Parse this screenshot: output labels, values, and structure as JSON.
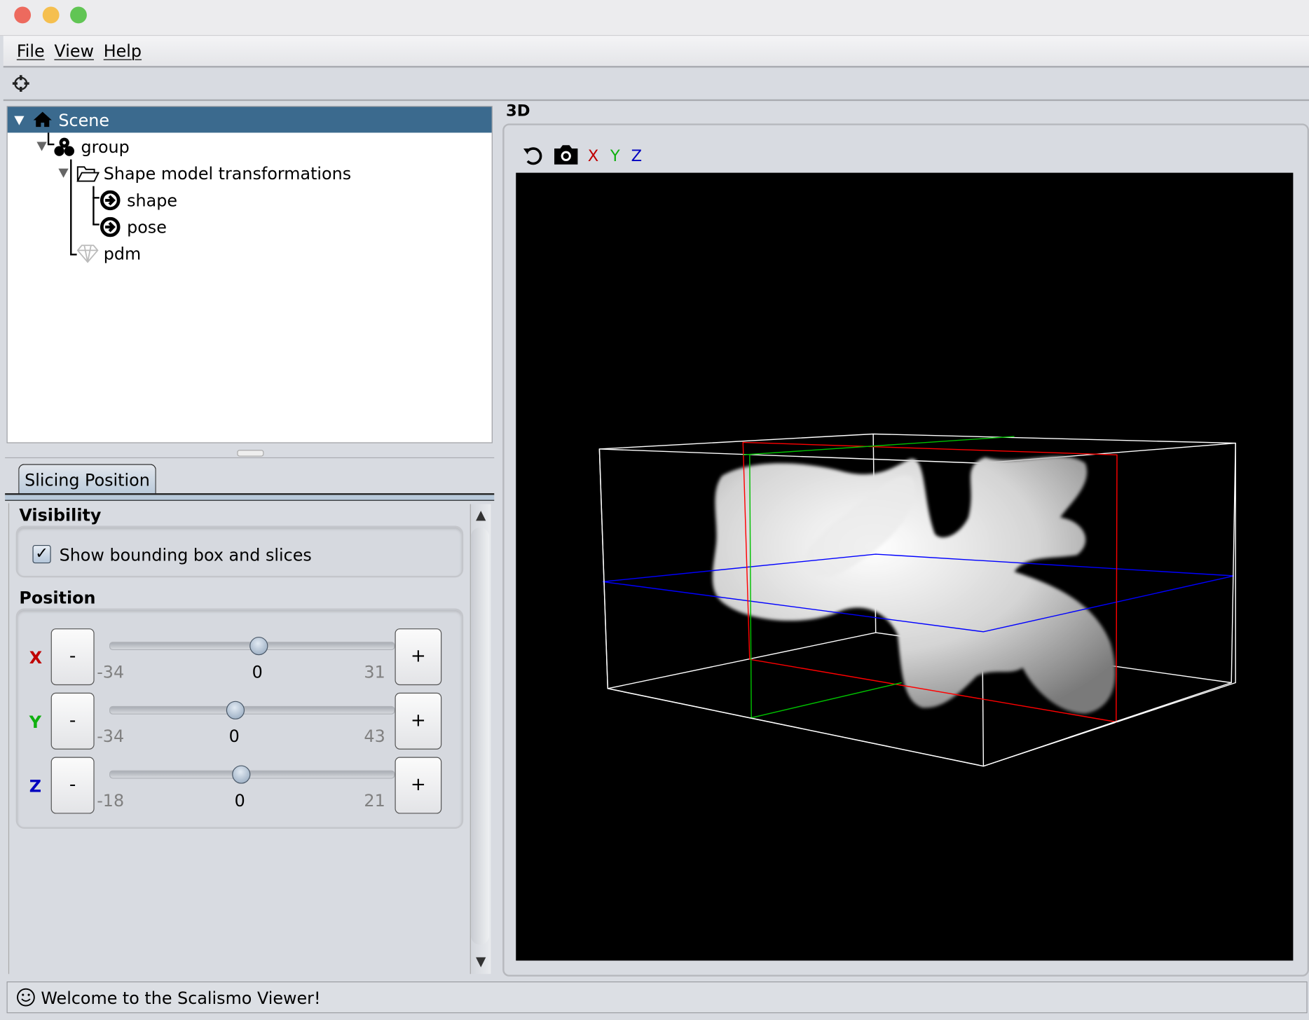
{
  "window": {
    "controls": [
      "close",
      "minimize",
      "maximize"
    ],
    "colors": {
      "close": "#ed6a5e",
      "minimize": "#f5bf4f",
      "maximize": "#61c554"
    }
  },
  "menubar": {
    "items": [
      "File",
      "View",
      "Help"
    ]
  },
  "toolbar": {
    "icons": [
      "crosshair-icon"
    ]
  },
  "tree": {
    "root": {
      "label": "Scene",
      "icon": "home-icon",
      "expanded": true,
      "selected": true
    },
    "nodes": [
      {
        "label": "group",
        "icon": "group-icon",
        "expanded": true
      },
      {
        "label": "Shape model transformations",
        "icon": "folder-open-icon",
        "expanded": true
      },
      {
        "label": "shape",
        "icon": "arrow-circle-icon"
      },
      {
        "label": "pose",
        "icon": "arrow-circle-icon"
      },
      {
        "label": "pdm",
        "icon": "diamond-icon"
      }
    ],
    "selection_color": "#3b6a8e"
  },
  "properties": {
    "tab": "Slicing Position",
    "visibility": {
      "title": "Visibility",
      "checkbox_label": "Show bounding box and slices",
      "checked": true
    },
    "position": {
      "title": "Position",
      "axes": [
        {
          "label": "X",
          "color": "#c00000",
          "min": "-34",
          "max": "31",
          "value": "0",
          "minus": "-",
          "plus": "+"
        },
        {
          "label": "Y",
          "color": "#10b010",
          "min": "-34",
          "max": "43",
          "value": "0",
          "minus": "-",
          "plus": "+"
        },
        {
          "label": "Z",
          "color": "#0000c0",
          "min": "-18",
          "max": "21",
          "value": "0",
          "minus": "-",
          "plus": "+"
        }
      ]
    }
  },
  "view3d": {
    "title": "3D",
    "toolbar": {
      "icons": [
        "reset-view-icon",
        "camera-icon"
      ],
      "axes": [
        {
          "label": "X",
          "color": "#c00000"
        },
        {
          "label": "Y",
          "color": "#10b010"
        },
        {
          "label": "Z",
          "color": "#0000c0"
        }
      ]
    },
    "background": "#000000"
  },
  "status": {
    "icon": "smiley-icon",
    "text": "Welcome to the Scalismo Viewer!"
  }
}
